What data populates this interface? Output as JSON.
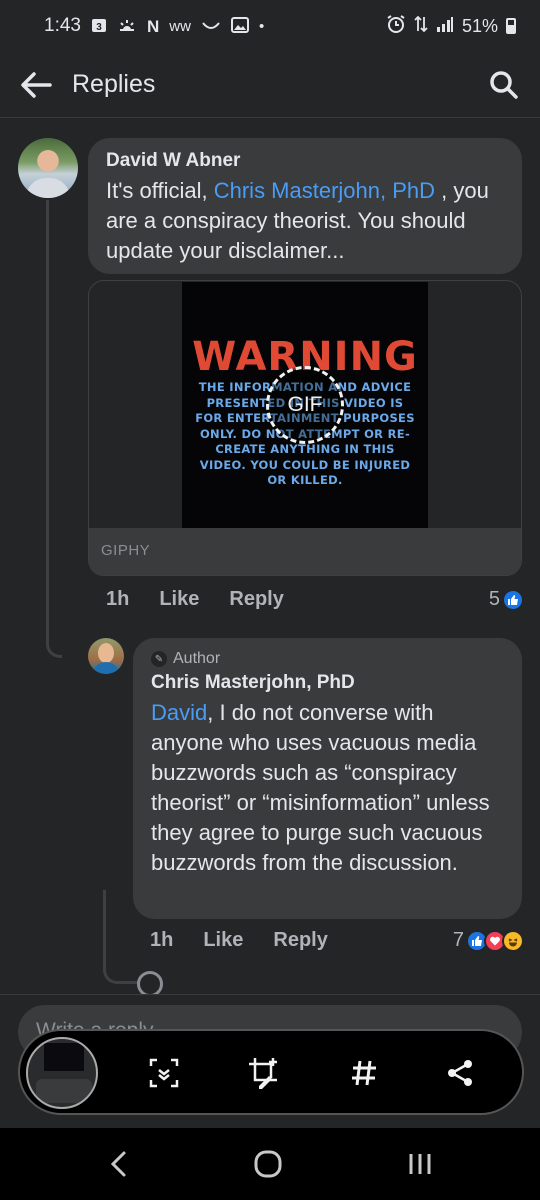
{
  "status_bar": {
    "time": "1:43",
    "notif_icons": [
      "calendar-icon",
      "weather-icon",
      "n-icon",
      "wave-icon",
      "smile-icon",
      "image-icon",
      "dot-icon"
    ],
    "calendar_day": "3",
    "n_letter": "N",
    "wave_text": "ww",
    "battery": "51%"
  },
  "header": {
    "title": "Replies"
  },
  "comments": [
    {
      "author": "David W Abner",
      "text_before": "It's official, ",
      "mention": "Chris Masterjohn, PhD",
      "text_after": " , you are a conspiracy theorist.  You should update your disclaimer...",
      "gif": {
        "title": "WARNING",
        "body": "THE INFORMATION AND ADVICE PRESENTED IN THIS VIDEO IS FOR ENTERTAINMENT PURPOSES ONLY. DO NOT ATTEMPT OR RE-CREATE ANYTHING IN THIS VIDEO. YOU COULD BE INJURED OR KILLED.",
        "badge": "GIF",
        "source": "GIPHY"
      },
      "time": "1h",
      "like_label": "Like",
      "reply_label": "Reply",
      "reaction_count": "5"
    },
    {
      "badge": "Author",
      "author": "Chris Masterjohn, PhD",
      "mention": "David",
      "text_after": ", I do not converse with anyone who uses vacuous media buzzwords such as “conspiracy theorist” or “misinformation” unless they agree to purge such vacuous buzzwords from the discussion.",
      "time": "1h",
      "like_label": "Like",
      "reply_label": "Reply",
      "reaction_count": "7"
    }
  ],
  "composer": {
    "placeholder": "Write a reply..."
  },
  "colors": {
    "background": "#242526",
    "bubble": "#3a3b3c",
    "mention": "#4a9cf5",
    "like": "#1b74e4",
    "love": "#f33e58",
    "haha": "#f7b928"
  }
}
